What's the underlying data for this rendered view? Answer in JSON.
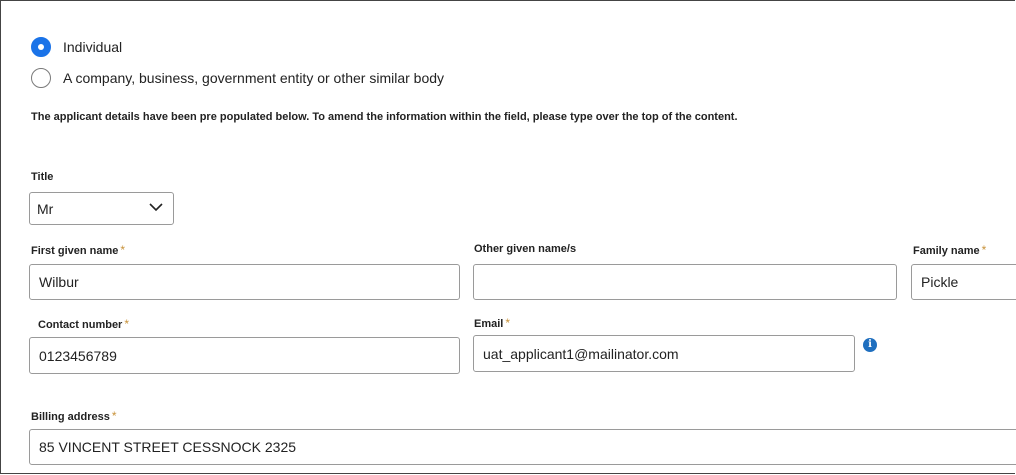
{
  "applicant_type": {
    "options": [
      {
        "label": "Individual",
        "checked": true
      },
      {
        "label": "A company, business, government entity or other similar body",
        "checked": false
      }
    ]
  },
  "instruction": "The applicant details have been pre populated below. To amend the information within the field, please type over the top of the content.",
  "title_field": {
    "label": "Title",
    "value": "Mr",
    "icon": "chevron-down-icon"
  },
  "required_marker": "*",
  "fields": {
    "first_given_name": {
      "label": "First given name",
      "value": "Wilbur"
    },
    "other_given_names": {
      "label": "Other given name/s",
      "value": ""
    },
    "family_name": {
      "label": "Family name",
      "value": "Pickle"
    },
    "contact_number": {
      "label": "Contact number",
      "value": "0123456789"
    },
    "email": {
      "label": "Email",
      "value": "uat_applicant1@mailinator.com",
      "info_icon": "info-icon",
      "info_glyph": "i"
    },
    "billing_address": {
      "label": "Billing address",
      "value": "85 VINCENT STREET CESSNOCK 2325"
    }
  },
  "colors": {
    "radio_selected": "#1a73e8",
    "required_star": "#c8923a",
    "info_icon": "#1f6fbf",
    "input_border": "#9a9a9a"
  }
}
